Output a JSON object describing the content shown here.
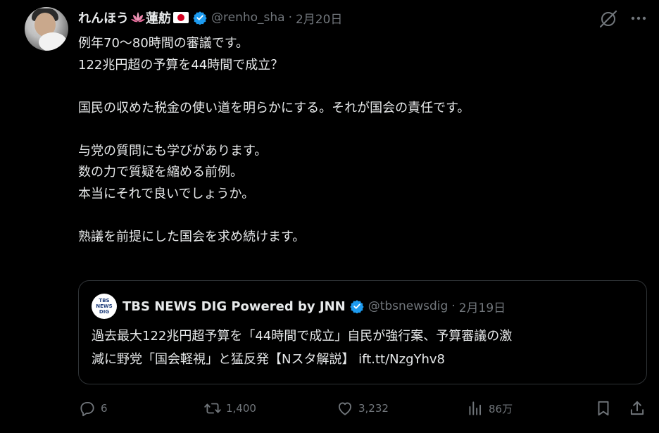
{
  "author": {
    "name": "れんほう",
    "name_suffix": "蓮舫",
    "handle": "@renho_sha",
    "date": "2月20日",
    "icons": [
      "lotus-icon",
      "japan-flag-icon",
      "verified-badge-icon"
    ]
  },
  "body_lines": [
    "例年70〜80時間の審議です。",
    "122兆円超の予算を44時間で成立？",
    "",
    "国民の収めた税金の使い道を明らかにする。それが国会の責任です。",
    "",
    "与党の質問にも学びがあります。",
    "数の力で質疑を縮める前例。",
    "本当にそれで良いでしょうか。",
    "",
    "熟議を前提にした国会を求め続けます。"
  ],
  "quote": {
    "logo_lines": [
      "TBS",
      "NEWS",
      "DIG"
    ],
    "name": "TBS NEWS DIG Powered by JNN",
    "handle": "@tbsnewsdig",
    "date": "2月19日",
    "text_lines": [
      "過去最大122兆円超予算を「44時間で成立」自民が強行案、予算審議の激",
      "減に野党「国会軽視」と猛反発【Nスタ解説】 ift.tt/NzgYhv8"
    ]
  },
  "actions": {
    "replies": "6",
    "reposts": "1,400",
    "likes": "3,232",
    "views": "86万"
  },
  "colors": {
    "background": "#000000",
    "text": "#e7e9ea",
    "muted": "#71767b",
    "border": "#2f3336",
    "verified": "#1d9bf0"
  }
}
